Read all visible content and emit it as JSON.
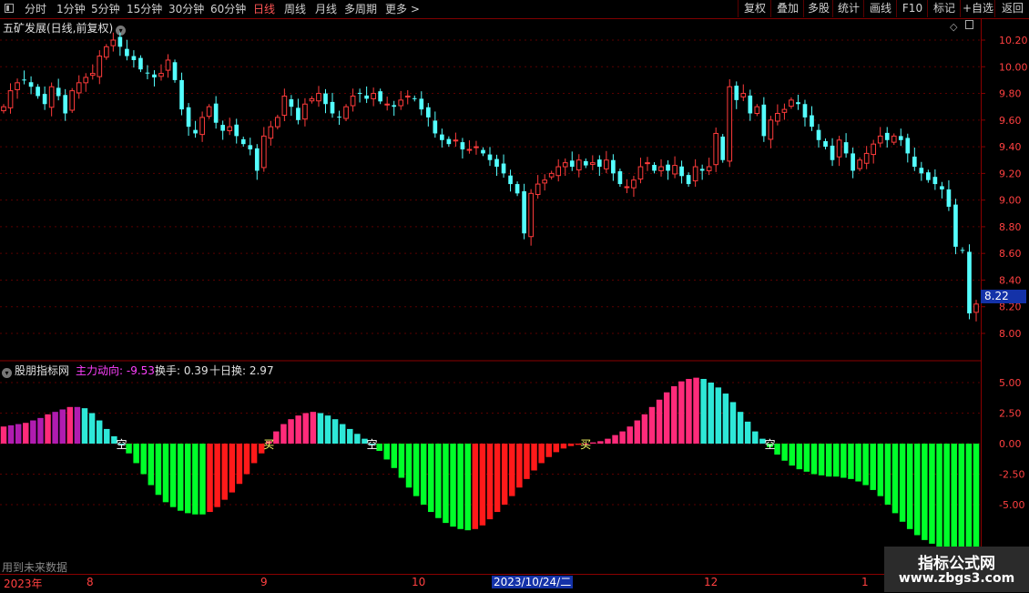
{
  "toolbar": {
    "periods": [
      "分时",
      "1分钟",
      "5分钟",
      "15分钟",
      "30分钟",
      "60分钟",
      "日线",
      "周线",
      "月线",
      "多周期",
      "更多 >"
    ],
    "active_period": "日线",
    "right_buttons": [
      "复权",
      "叠加",
      "多股",
      "统计",
      "画线",
      "F10",
      "标记",
      "+自选",
      "返回"
    ]
  },
  "main_chart": {
    "title": "五矿发展(日线,前复权)",
    "price_axis": [
      "10.20",
      "10.00",
      "9.80",
      "9.60",
      "9.40",
      "9.20",
      "9.00",
      "8.80",
      "8.60",
      "8.40",
      "8.20",
      "8.00"
    ],
    "last_price": "8.22"
  },
  "indicator": {
    "name": "股朋指标网",
    "label1": "主力动向: -9.53",
    "label2": "换手: 0.39",
    "label3": "十日换: 2.97",
    "axis": [
      "5.00",
      "2.50",
      "0.00",
      "-2.50",
      "-5.00"
    ],
    "signals": [
      "空",
      "买",
      "空",
      "买",
      "空"
    ]
  },
  "date_axis": {
    "ticks": [
      "2023年",
      "8",
      "9",
      "10",
      "12",
      "1"
    ],
    "selected": "2023/10/24/二"
  },
  "footer_note": "用到未来数据",
  "watermark": {
    "line1": "指标公式网",
    "line2": "www.zbgs3.com"
  },
  "chart_data": {
    "type": "candlestick",
    "ylim": [
      7.85,
      10.3
    ],
    "closes": [
      9.7,
      9.82,
      9.88,
      9.9,
      9.85,
      9.78,
      9.72,
      9.85,
      9.78,
      9.65,
      9.82,
      9.88,
      9.92,
      9.95,
      10.08,
      10.15,
      10.2,
      10.15,
      10.08,
      10.05,
      9.98,
      9.95,
      9.92,
      9.95,
      10.05,
      9.9,
      9.68,
      9.55,
      9.5,
      9.62,
      9.7,
      9.58,
      9.52,
      9.55,
      9.48,
      9.42,
      9.38,
      9.22,
      9.48,
      9.55,
      9.62,
      9.78,
      9.7,
      9.6,
      9.72,
      9.76,
      9.8,
      9.72,
      9.65,
      9.62,
      9.7,
      9.78,
      9.8,
      9.76,
      9.8,
      9.74,
      9.72,
      9.7,
      9.75,
      9.78,
      9.76,
      9.68,
      9.62,
      9.5,
      9.45,
      9.42,
      9.45,
      9.38,
      9.38,
      9.4,
      9.35,
      9.3,
      9.25,
      9.2,
      9.12,
      9.05,
      8.75,
      9.05,
      9.12,
      9.15,
      9.2,
      9.25,
      9.28,
      9.25,
      9.3,
      9.26,
      9.28,
      9.25,
      9.3,
      9.2,
      9.12,
      9.1,
      9.15,
      9.25,
      9.28,
      9.22,
      9.25,
      9.22,
      9.26,
      9.18,
      9.12,
      9.25,
      9.22,
      9.25,
      9.5,
      9.3,
      9.85,
      9.75,
      9.8,
      9.65,
      9.7,
      9.48,
      9.6,
      9.65,
      9.68,
      9.75,
      9.72,
      9.62,
      9.55,
      9.45,
      9.4,
      9.3,
      9.45,
      9.35,
      9.22,
      9.3,
      9.35,
      9.42,
      9.48,
      9.45,
      9.48,
      9.45,
      9.35,
      9.25,
      9.2,
      9.15,
      9.12,
      9.08,
      8.95,
      8.65,
      8.62,
      8.15,
      8.22
    ],
    "indicator_type": "histogram",
    "indicator_values": [
      1.4,
      1.5,
      1.6,
      1.7,
      1.9,
      2.1,
      2.4,
      2.6,
      2.8,
      3.0,
      3.0,
      2.9,
      2.5,
      1.9,
      1.2,
      0.6,
      0.0,
      -0.8,
      -1.6,
      -2.5,
      -3.4,
      -4.2,
      -4.8,
      -5.2,
      -5.5,
      -5.7,
      -5.8,
      -5.8,
      -5.6,
      -5.2,
      -4.6,
      -4.0,
      -3.3,
      -2.5,
      -1.6,
      -0.8,
      0.2,
      1.0,
      1.6,
      2.0,
      2.3,
      2.5,
      2.6,
      2.5,
      2.3,
      2.0,
      1.6,
      1.2,
      0.8,
      0.4,
      0.0,
      -0.6,
      -1.3,
      -2.0,
      -2.8,
      -3.6,
      -4.3,
      -5.0,
      -5.6,
      -6.1,
      -6.5,
      -6.8,
      -7.0,
      -7.1,
      -7.0,
      -6.7,
      -6.2,
      -5.6,
      -5.0,
      -4.3,
      -3.6,
      -2.9,
      -2.2,
      -1.6,
      -1.1,
      -0.7,
      -0.4,
      -0.2,
      -0.1,
      0.0,
      0.1,
      0.2,
      0.4,
      0.7,
      1.0,
      1.4,
      1.9,
      2.4,
      3.0,
      3.6,
      4.2,
      4.7,
      5.1,
      5.3,
      5.4,
      5.3,
      5.0,
      4.6,
      4.1,
      3.4,
      2.6,
      1.8,
      1.0,
      0.4,
      -0.3,
      -0.9,
      -1.4,
      -1.8,
      -2.1,
      -2.3,
      -2.5,
      -2.6,
      -2.7,
      -2.7,
      -2.8,
      -2.9,
      -3.1,
      -3.4,
      -3.8,
      -4.3,
      -5.0,
      -5.7,
      -6.4,
      -7.0,
      -7.5,
      -7.9,
      -8.2,
      -8.5,
      -8.8,
      -9.1,
      -9.3,
      -9.5,
      -9.53
    ]
  }
}
